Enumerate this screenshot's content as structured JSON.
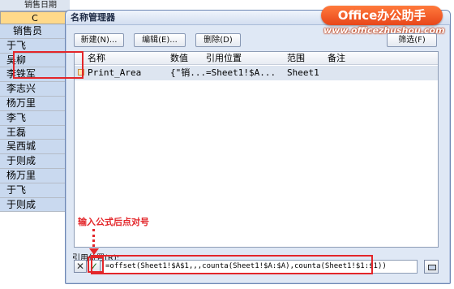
{
  "sheet": {
    "top_label": "销售日期",
    "column_letter": "C",
    "cells": [
      "销售员",
      "于飞",
      "吴柳",
      "李铁军",
      "李志兴",
      "杨万里",
      "李飞",
      "王磊",
      "吴西城",
      "于则成",
      "杨万里",
      "于飞",
      "于则成"
    ]
  },
  "dialog": {
    "title": "名称管理器",
    "buttons": {
      "new": "新建(N)...",
      "edit": "编辑(E)...",
      "delete": "删除(D)",
      "filter": "筛选(F)"
    },
    "columns": [
      "名称",
      "数值",
      "引用位置",
      "范围",
      "备注"
    ],
    "rows": [
      {
        "name": "Print_Area",
        "value": "{\"销...",
        "ref": "=Sheet1!$A...",
        "scope": "Sheet1",
        "comment": ""
      }
    ],
    "ref_label": "引用位置(R):",
    "ref_value": "=offset(Sheet1!$A$1,,,counta(Sheet1!$A:$A),counta(Sheet1!$1:$1))",
    "cancel_glyph": "✕",
    "confirm_glyph": "✓"
  },
  "watermark": {
    "brand": "Office办公助手",
    "site": "www.officezhushou.com"
  },
  "annotation": "输入公式后点对号",
  "colors": {
    "highlight_red": "#e3262a",
    "column_fill": "#c9d9ef",
    "dialog_bg": "#dfe8f5"
  }
}
